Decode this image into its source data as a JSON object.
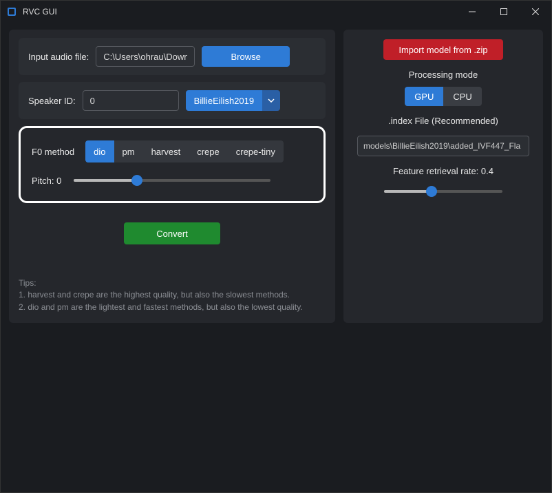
{
  "window": {
    "title": "RVC GUI"
  },
  "left": {
    "input_audio_label": "Input audio file:",
    "input_audio_value": "C:\\Users\\ohrau\\Downl",
    "browse_label": "Browse",
    "speaker_id_label": "Speaker ID:",
    "speaker_id_value": "0",
    "model_dropdown_value": "BillieEilish2019",
    "f0_method_label": "F0 method",
    "f0_methods": [
      "dio",
      "pm",
      "harvest",
      "crepe",
      "crepe-tiny"
    ],
    "pitch_label": "Pitch: 0",
    "convert_label": "Convert",
    "tips_heading": "Tips:",
    "tips_line1": "1. harvest and crepe are the highest quality, but also the slowest methods.",
    "tips_line2": "2. dio and pm are the lightest and fastest methods, but also the lowest quality."
  },
  "right": {
    "import_label": "Import model from .zip",
    "processing_mode_label": "Processing mode",
    "mode_options": [
      "GPU",
      "CPU"
    ],
    "index_file_label": ".index File (Recommended)",
    "index_file_value": "models\\BillieEilish2019\\added_IVF447_Fla",
    "feature_rate_label": "Feature retrieval rate: 0.4"
  },
  "slider": {
    "pitch_pct": 32,
    "feature_pct": 40
  }
}
